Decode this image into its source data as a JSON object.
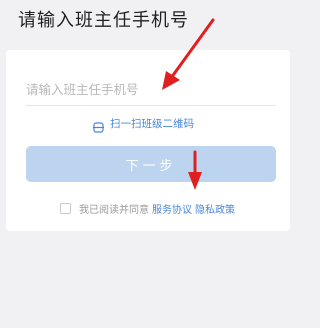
{
  "header": {
    "title": "请输入班主任手机号"
  },
  "form": {
    "phone_placeholder": "请输入班主任手机号",
    "phone_value": "",
    "scan_label": "扫一扫班级二维码",
    "next_label": "下一步",
    "agree_prefix": "我已阅读并同意",
    "service_agreement": "服务协议",
    "privacy_policy": "隐私政策",
    "agree_checked": false
  },
  "colors": {
    "accent": "#4a86d8",
    "button_disabled": "#bcd4f0",
    "annotation_arrow": "#e0201f",
    "background": "#f1f1f3"
  }
}
